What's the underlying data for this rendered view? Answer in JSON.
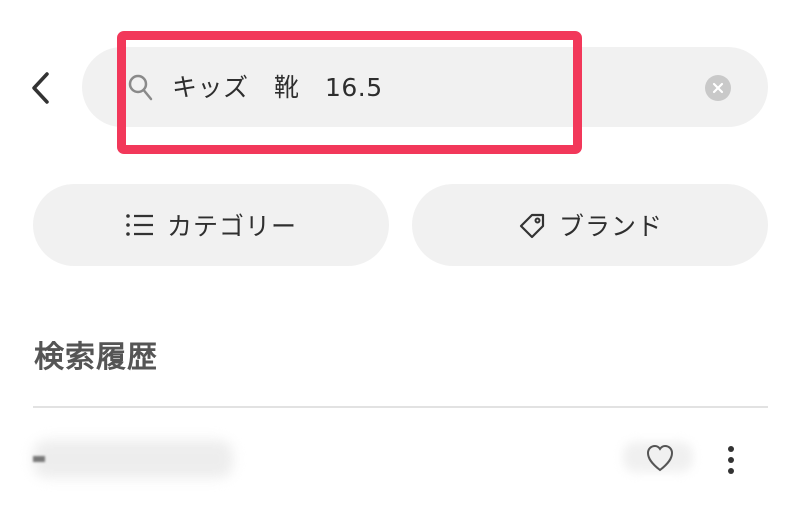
{
  "header": {
    "back_icon": "chevron-left-icon",
    "search": {
      "icon": "search-icon",
      "value": "キッズ　靴　16.5",
      "clear_icon": "close-circle-icon"
    },
    "highlight_color": "#f2385a"
  },
  "filters": {
    "category": {
      "icon": "list-icon",
      "label": "カテゴリー"
    },
    "brand": {
      "icon": "tag-icon",
      "label": "ブランド"
    }
  },
  "history": {
    "heading": "検索履歴",
    "items": [
      {
        "text_blurred": true,
        "favorite_icon": "heart-icon",
        "more_icon": "more-vertical-icon"
      }
    ]
  },
  "colors": {
    "surface": "#f1f1f1",
    "text_primary": "#2e2e2e",
    "heading": "#555555",
    "divider": "#e2e2e2"
  }
}
